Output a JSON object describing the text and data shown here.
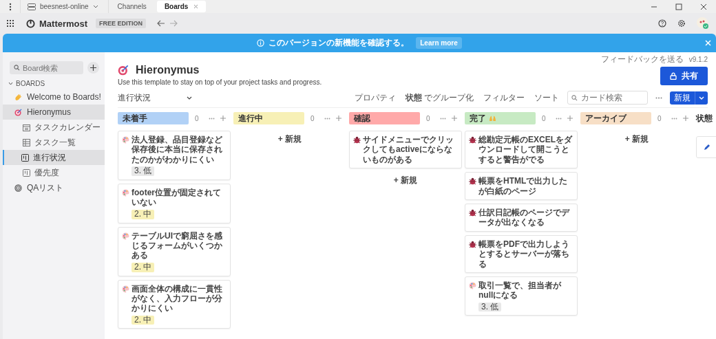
{
  "workspace": {
    "label": "beesnest-online"
  },
  "browser_tabs": [
    {
      "label": "Channels",
      "selected": false
    },
    {
      "label": "Boards",
      "selected": true
    }
  ],
  "app_header": {
    "product": "Mattermost",
    "edition": "FREE EDITION"
  },
  "banner": {
    "message": "このバージョンの新機能を確認する。",
    "action": "Learn more"
  },
  "sidebar": {
    "search": {
      "placeholder": "Board検索"
    },
    "section": "BOARDS",
    "section_expanded": true,
    "items": [
      {
        "label": "Welcome to Boards!",
        "kind": "wave",
        "selected": false
      },
      {
        "label": "Hieronymus",
        "kind": "target",
        "selected": true,
        "children": [
          {
            "label": "タスクカレンダー",
            "kind": "calendar",
            "selected": false
          },
          {
            "label": "タスク一覧",
            "kind": "table",
            "selected": false
          },
          {
            "label": "進行状況",
            "kind": "board",
            "selected": true
          },
          {
            "label": "優先度",
            "kind": "board",
            "selected": false
          }
        ]
      },
      {
        "label": "QAリスト",
        "kind": "spiral",
        "selected": false
      }
    ]
  },
  "board": {
    "feedback": "フィードバックを送る",
    "version": "v9.1.2",
    "title": "Hieronymus",
    "description": "Use this template to stay on top of your project tasks and progress.",
    "share": "共有",
    "view": "進行状況",
    "toolbar": {
      "properties": "プロパティ",
      "group_by": "**状態** でグループ化",
      "filter": "フィルター",
      "sort": "ソート",
      "search_placeholder": "カード検索",
      "new": "新規"
    },
    "columns": [
      {
        "label": "未着手",
        "color": "#b1d1f6",
        "count": "0",
        "cards": [
          {
            "kind": "palette",
            "title": "法人登録、品目登録など保存後に本当に保存されたのかがわかりにくい",
            "tag": {
              "label": "3. 低",
              "color": "#e8e8e8"
            }
          },
          {
            "kind": "palette",
            "title": "footer位置が固定されていない",
            "tag": {
              "label": "2. 中",
              "color": "#f7f0b6"
            }
          },
          {
            "kind": "palette",
            "title": "テーブルUIで窮屈さを感じるフォームがいくつかある",
            "tag": {
              "label": "2. 中",
              "color": "#f7f0b6"
            }
          },
          {
            "kind": "palette",
            "title": "画面全体の構成に一貫性がなく、入力フローが分かりにくい",
            "tag": {
              "label": "2. 中",
              "color": "#f7f0b6"
            }
          }
        ]
      },
      {
        "label": "進行中",
        "color": "#f7f0b6",
        "count": "0",
        "add": "+ 新規"
      },
      {
        "label": "確認",
        "color": "#ffa9a9",
        "count": "0",
        "add": "+ 新規",
        "cards": [
          {
            "kind": "bug",
            "title": "サイドメニューでクリックしてもactiveにならないものがある"
          }
        ]
      },
      {
        "label": "完了",
        "color": "#c7eac3",
        "count": "0",
        "emoji": true,
        "cards": [
          {
            "kind": "bug",
            "title": "総勘定元帳のEXCELをダウンロードして開こうとすると警告がでる"
          },
          {
            "kind": "bug",
            "title": "帳票をHTMLで出力したが白紙のページ"
          },
          {
            "kind": "bug",
            "title": "仕訳日記帳のページでデータが出なくなる"
          },
          {
            "kind": "bug",
            "title": "帳票をPDFで出力しようとするとサーバーが落ちる"
          },
          {
            "kind": "palette",
            "title": "取引一覧で、担当者がnullになる",
            "tag": {
              "label": "3. 低",
              "color": "#e8e8e8"
            }
          }
        ]
      },
      {
        "label": "アーカイブ",
        "color": "#f7dfc6",
        "count": "0",
        "add": "+ 新規"
      }
    ],
    "hidden_column": "状態"
  }
}
